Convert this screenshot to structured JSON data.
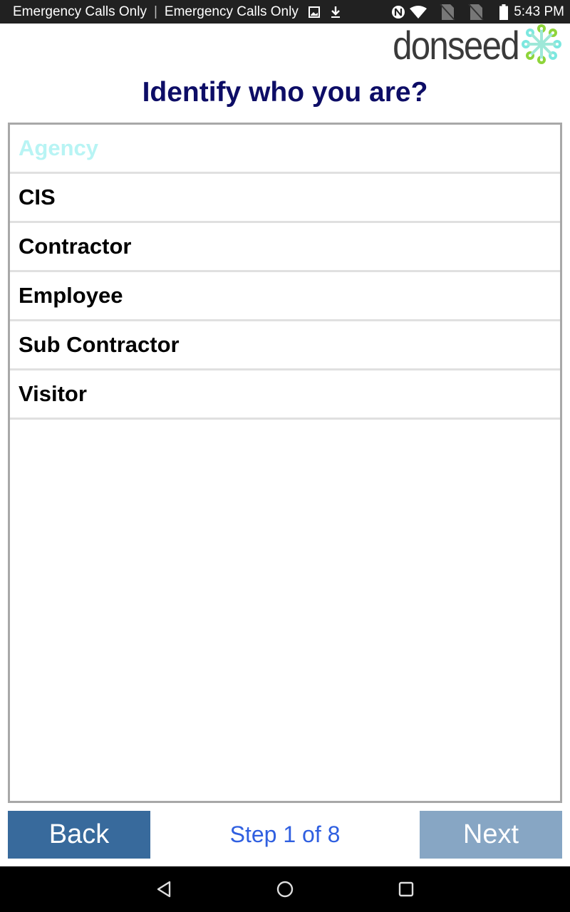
{
  "status_bar": {
    "carrier_1": "Emergency Calls Only",
    "separator": "|",
    "carrier_2": "Emergency Calls Only",
    "time": "5:43 PM",
    "icons": [
      "image-icon",
      "download-icon",
      "nfc-icon",
      "wifi-icon",
      "no-sim-icon",
      "no-sim-icon",
      "battery-icon"
    ]
  },
  "header": {
    "logo_text": "donseed",
    "logo_colors": {
      "teal": "#7de8e0",
      "green": "#8ed43a"
    }
  },
  "page": {
    "title": "Identify who you are?"
  },
  "list": {
    "placeholder": "Agency",
    "items": [
      {
        "label": "CIS"
      },
      {
        "label": "Contractor"
      },
      {
        "label": "Employee"
      },
      {
        "label": "Sub Contractor"
      },
      {
        "label": "Visitor"
      }
    ]
  },
  "footer": {
    "back_label": "Back",
    "next_label": "Next",
    "step_text": "Step 1 of 8",
    "current_step": 1,
    "total_steps": 8
  },
  "colors": {
    "title": "#0d0d66",
    "back_button": "#386a9c",
    "next_button_disabled": "#87a6c4",
    "step_text": "#2f5fe0",
    "placeholder": "#b8f4f4"
  }
}
